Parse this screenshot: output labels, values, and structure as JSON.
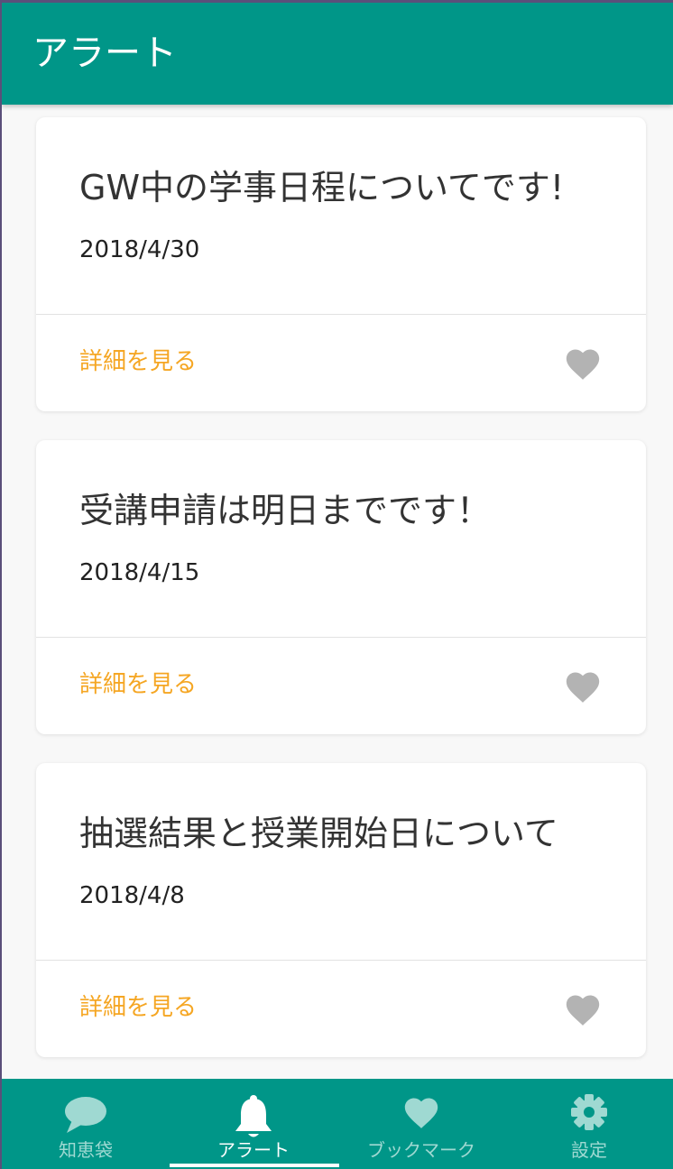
{
  "appbar": {
    "title": "アラート"
  },
  "alerts": [
    {
      "title": "GW中の学事日程についてです!",
      "date": "2018/4/30",
      "link_label": "詳細を見る"
    },
    {
      "title": "受講申請は明日までです！",
      "date": "2018/4/15",
      "link_label": "詳細を見る"
    },
    {
      "title": "抽選結果と授業開始日について",
      "date": "2018/4/8",
      "link_label": "詳細を見る"
    }
  ],
  "tabs": [
    {
      "label": "知恵袋",
      "icon": "chat-bubble-icon"
    },
    {
      "label": "アラート",
      "icon": "bell-icon",
      "active": true
    },
    {
      "label": "ブックマーク",
      "icon": "heart-icon"
    },
    {
      "label": "設定",
      "icon": "gear-icon"
    }
  ],
  "colors": {
    "primary": "#009688",
    "accent": "#f5a623",
    "heart": "#b3b3b3",
    "tab_inactive": "#9fd9d2",
    "tab_active": "#ffffff"
  }
}
